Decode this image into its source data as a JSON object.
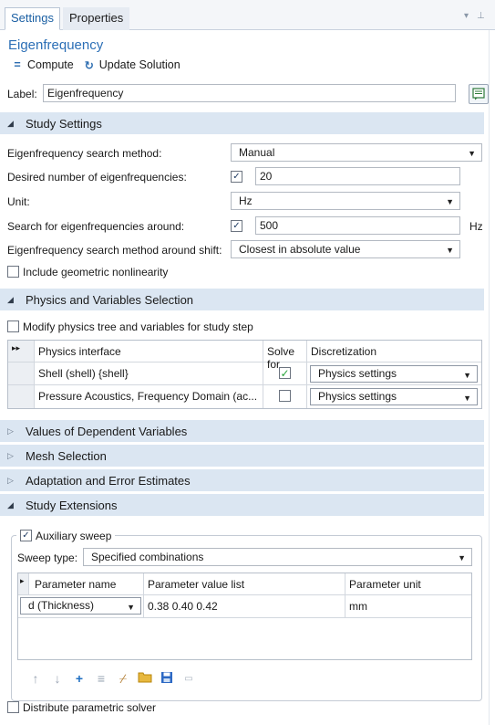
{
  "tabs": [
    {
      "label": "Settings"
    },
    {
      "label": "Properties"
    }
  ],
  "header": {
    "title": "Eigenfrequency",
    "compute_label": "Compute",
    "update_label": "Update Solution"
  },
  "label_field": {
    "label": "Label:",
    "value": "Eigenfrequency"
  },
  "sections": {
    "study_settings": "Study Settings",
    "physics_vars": "Physics and Variables Selection",
    "dependent_vars": "Values of Dependent Variables",
    "mesh_selection": "Mesh Selection",
    "adaptation": "Adaptation and Error Estimates",
    "study_extensions": "Study Extensions"
  },
  "study_settings": {
    "search_method_label": "Eigenfrequency search method:",
    "search_method_value": "Manual",
    "desired_number_label": "Desired number of eigenfrequencies:",
    "desired_number_checked": true,
    "desired_number_value": "20",
    "unit_label": "Unit:",
    "unit_value": "Hz",
    "search_around_label": "Search for eigenfrequencies around:",
    "search_around_checked": true,
    "search_around_value": "500",
    "search_around_unit": "Hz",
    "shift_method_label": "Eigenfrequency search method around shift:",
    "shift_method_value": "Closest in absolute value",
    "geometric_nonlinearity_label": "Include geometric nonlinearity",
    "geometric_nonlinearity_checked": false
  },
  "physics_selection": {
    "modify_label": "Modify physics tree and variables for study step",
    "modify_checked": false,
    "columns": [
      "Physics interface",
      "Solve for",
      "Discretization"
    ],
    "rows": [
      {
        "interface": "Shell (shell) {shell}",
        "solve_for": true,
        "discretization": "Physics settings"
      },
      {
        "interface": "Pressure Acoustics, Frequency Domain (ac...",
        "solve_for": false,
        "discretization": "Physics settings"
      }
    ]
  },
  "study_extensions": {
    "auxiliary_sweep_label": "Auxiliary sweep",
    "auxiliary_sweep_checked": true,
    "sweep_type_label": "Sweep type:",
    "sweep_type_value": "Specified combinations",
    "columns": [
      "Parameter name",
      "Parameter value list",
      "Parameter unit"
    ],
    "rows": [
      {
        "name": "d (Thickness)",
        "values": "0.38 0.40 0.42",
        "unit": "mm"
      }
    ],
    "distribute_label": "Distribute parametric solver",
    "distribute_checked": false
  },
  "icons": {
    "compute": "equals-icon",
    "update": "refresh-icon",
    "notes": "notes-icon",
    "move_up": "arrow-up-icon",
    "move_down": "arrow-down-icon",
    "add": "plus-icon",
    "delete": "delete-list-icon",
    "clear": "broom-icon",
    "load": "folder-icon",
    "save": "save-icon",
    "range": "range-icon"
  },
  "colors": {
    "accent": "#2c6fb6",
    "section_bg": "#dbe6f2",
    "check_green": "#28a43a"
  }
}
